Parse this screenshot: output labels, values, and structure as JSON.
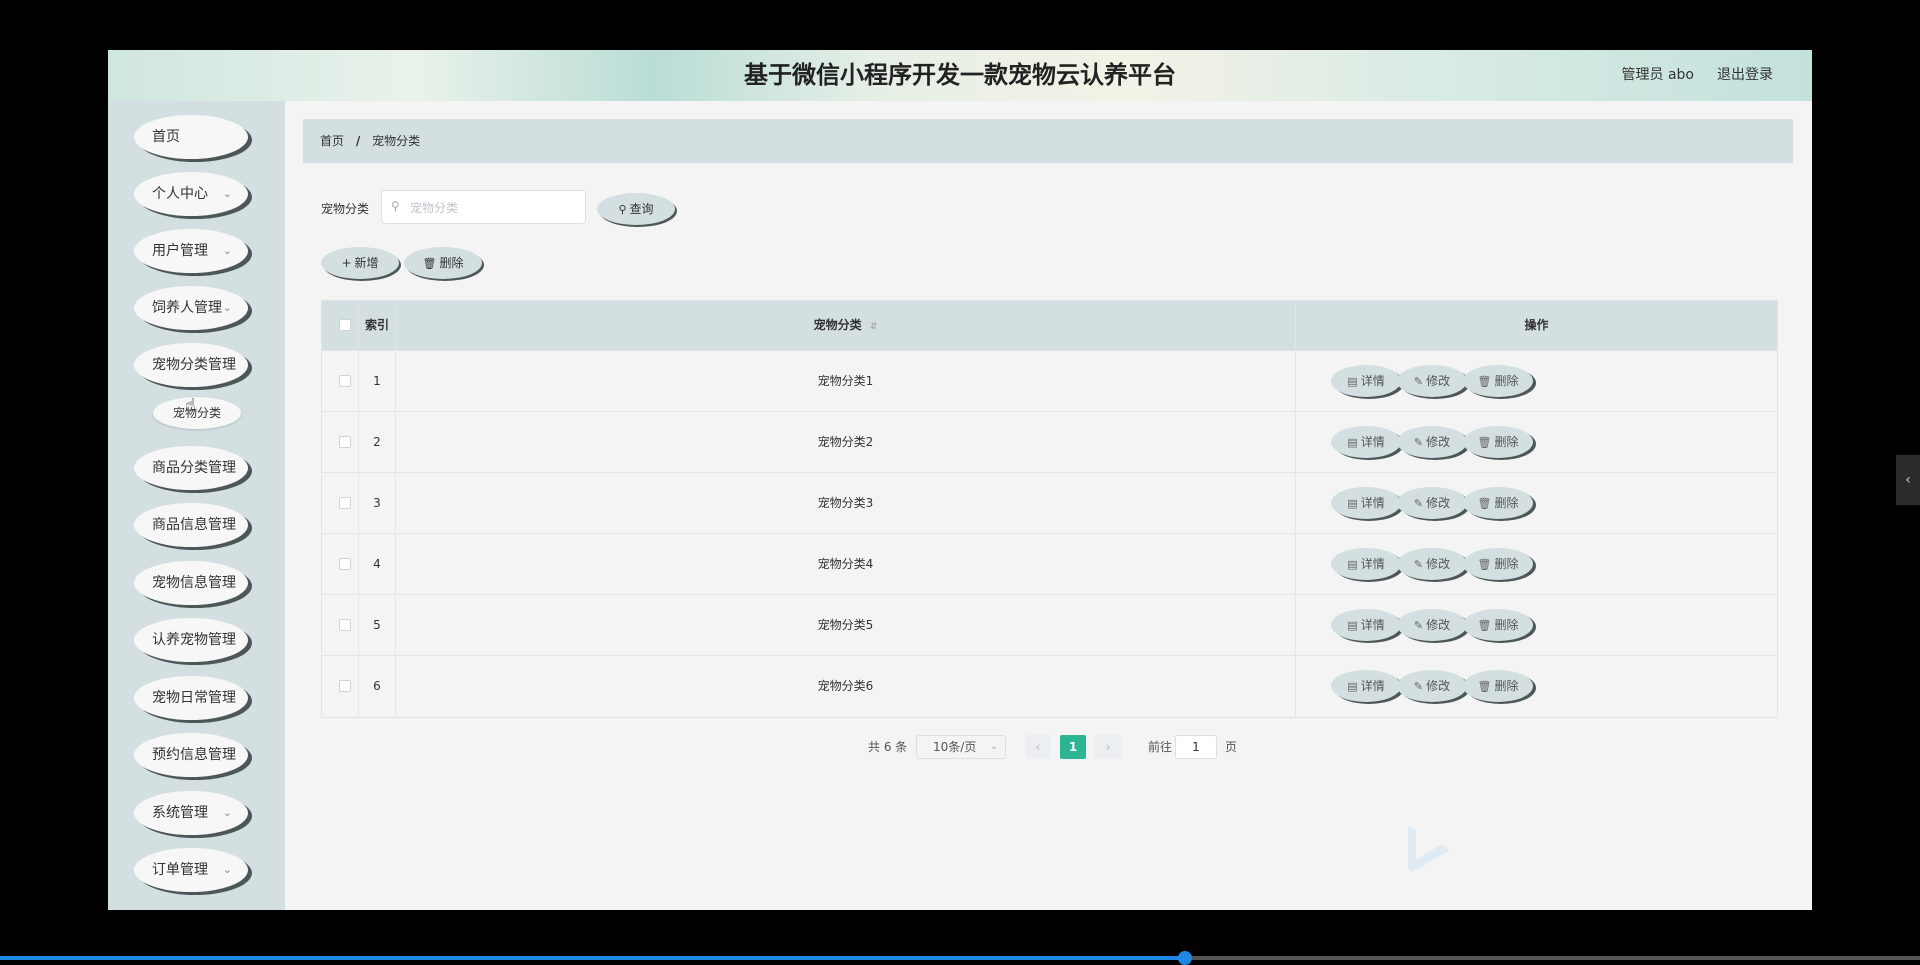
{
  "header": {
    "title": "基于微信小程序开发一款宠物云认养平台",
    "user": "管理员 abo",
    "logout": "退出登录"
  },
  "sidebar": {
    "items": [
      {
        "label": "首页",
        "chevron": false
      },
      {
        "label": "个人中心",
        "chevron": true
      },
      {
        "label": "用户管理",
        "chevron": true
      },
      {
        "label": "饲养人管理",
        "chevron": true
      },
      {
        "label": "宠物分类管理",
        "chevron": false
      },
      {
        "label": "商品分类管理",
        "chevron": false
      },
      {
        "label": "商品信息管理",
        "chevron": false
      },
      {
        "label": "宠物信息管理",
        "chevron": false
      },
      {
        "label": "认养宠物管理",
        "chevron": false
      },
      {
        "label": "宠物日常管理",
        "chevron": false
      },
      {
        "label": "预约信息管理",
        "chevron": false
      },
      {
        "label": "系统管理",
        "chevron": true
      },
      {
        "label": "订单管理",
        "chevron": true
      }
    ],
    "subitem": "宠物分类"
  },
  "breadcrumb": {
    "home": "首页",
    "sep": "/",
    "current": "宠物分类"
  },
  "search": {
    "label": "宠物分类",
    "placeholder": "宠物分类",
    "value": "",
    "button": "查询"
  },
  "actions": {
    "add": "新增",
    "delete": "删除"
  },
  "table": {
    "headers": {
      "index": "索引",
      "category": "宠物分类",
      "ops": "操作"
    },
    "rows": [
      {
        "index": "1",
        "category": "宠物分类1"
      },
      {
        "index": "2",
        "category": "宠物分类2"
      },
      {
        "index": "3",
        "category": "宠物分类3"
      },
      {
        "index": "4",
        "category": "宠物分类4"
      },
      {
        "index": "5",
        "category": "宠物分类5"
      },
      {
        "index": "6",
        "category": "宠物分类6"
      }
    ],
    "ops": {
      "detail": "详情",
      "edit": "修改",
      "delete": "删除"
    }
  },
  "pagination": {
    "total": "共 6 条",
    "page_size": "10条/页",
    "current": "1",
    "goto": "前往",
    "goto_value": "1",
    "page_unit": "页"
  },
  "video_progress": 0.617
}
